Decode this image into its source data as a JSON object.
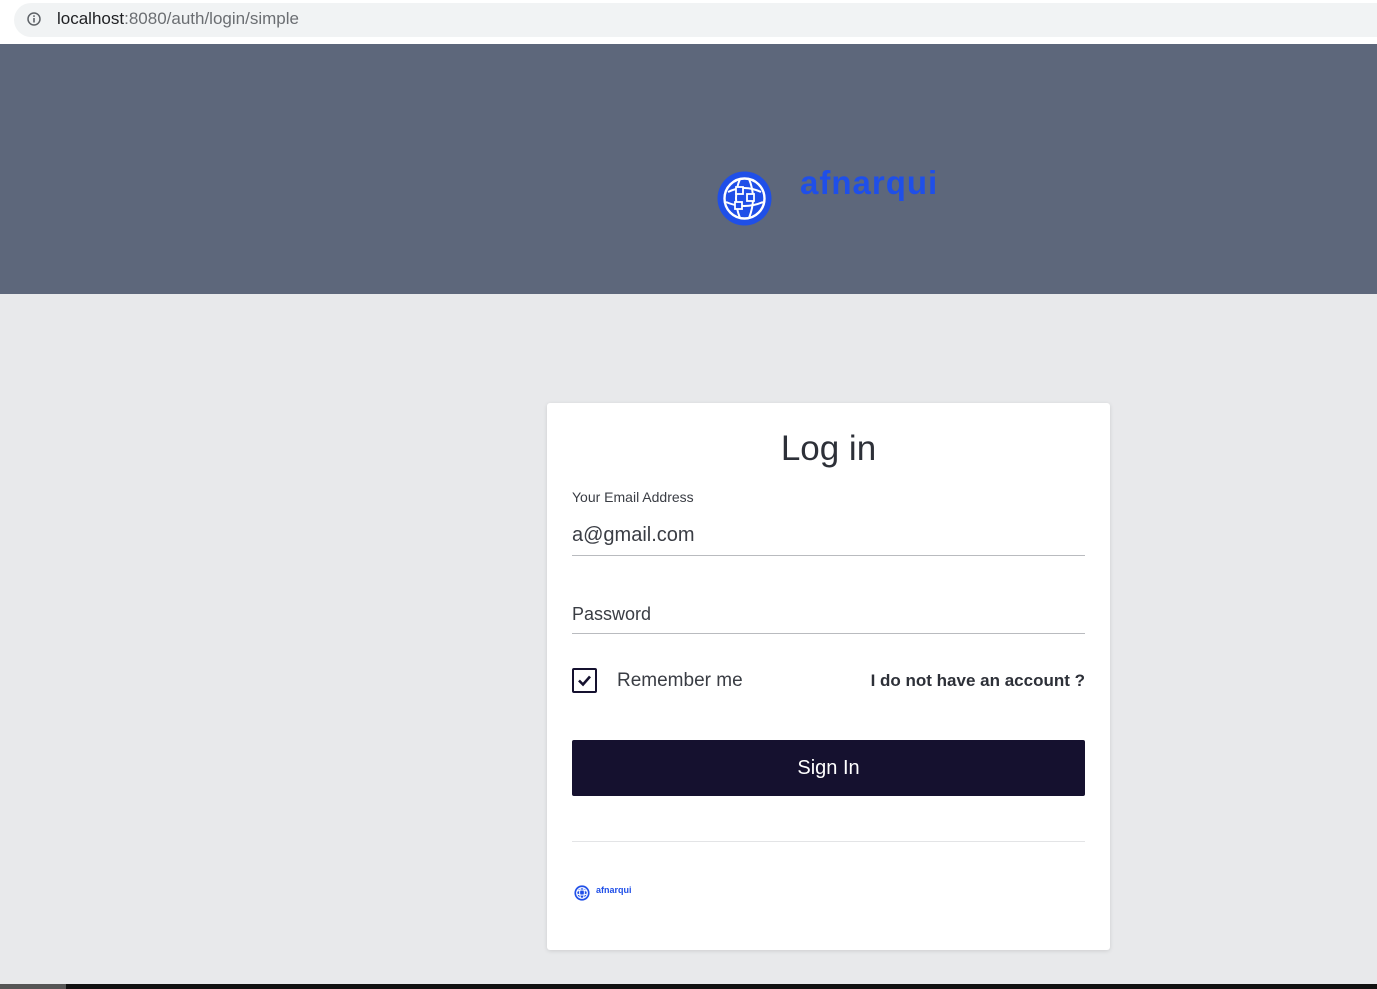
{
  "browser": {
    "url_host": "localhost",
    "url_rest": ":8080/auth/login/simple",
    "info_icon": "info-icon"
  },
  "header": {
    "logo_icon": "globe-network-icon",
    "brand_name": "afnarqui",
    "brand_color": "#1f4fe8",
    "background": "#5d677b"
  },
  "login": {
    "title": "Log in",
    "email_label": "Your Email Address",
    "email_value": "a@gmail.com",
    "password_placeholder": "Password",
    "remember_label": "Remember me",
    "remember_checked": true,
    "no_account_link": "I do not have an account ?",
    "signin_label": "Sign In",
    "button_color": "#15112f"
  },
  "footer": {
    "brand_name": "afnarqui",
    "logo_icon": "globe-network-icon"
  }
}
